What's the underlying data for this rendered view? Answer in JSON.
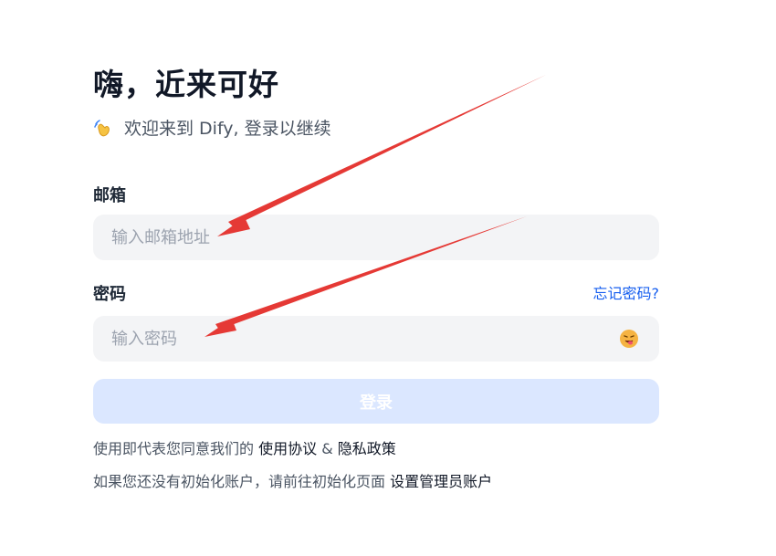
{
  "header": {
    "title": "嗨，近来可好",
    "subtitle": "欢迎来到 Dify, 登录以继续"
  },
  "form": {
    "email": {
      "label": "邮箱",
      "placeholder": "输入邮箱地址",
      "value": ""
    },
    "password": {
      "label": "密码",
      "placeholder": "输入密码",
      "value": "",
      "forgot_label": "忘记密码?"
    },
    "login_label": "登录"
  },
  "footer": {
    "terms_prefix": "使用即代表您同意我们的",
    "terms_link": "使用协议",
    "terms_joiner": "&",
    "privacy_link": "隐私政策",
    "setup_prefix": "如果您还没有初始化账户，请前往初始化页面",
    "setup_link": "设置管理员账户"
  },
  "icons": {
    "subtitle_icon": "waving-hand-icon",
    "password_toggle_icon": "emoji-face-icon"
  },
  "colors": {
    "accent": "#155eef",
    "input_bg": "#f3f4f6",
    "button_bg": "#dbe7ff",
    "annotation_arrow": "#e53935"
  }
}
